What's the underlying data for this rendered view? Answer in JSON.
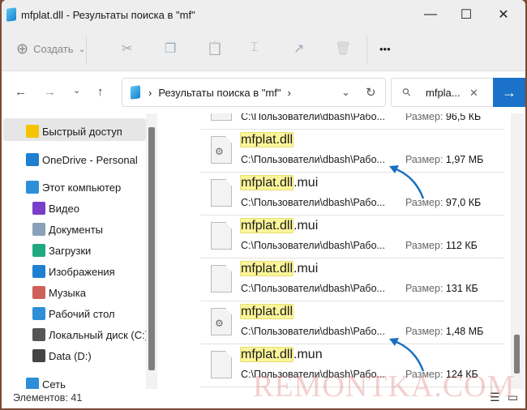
{
  "window": {
    "title": "mfplat.dll - Результаты поиска в \"mf\"",
    "minimize": "—",
    "maximize": "☐",
    "close": "✕"
  },
  "toolbar": {
    "create_label": "Создать",
    "create_icon": "⊕",
    "chevron": "⌄",
    "cut": "✂",
    "copy": "❐",
    "paste": "📋",
    "rename": "⌶",
    "share": "↗",
    "delete": "🗑",
    "more": "•••"
  },
  "nav": {
    "back": "←",
    "forward": "→",
    "recent": "⌄",
    "up": "↑",
    "breadcrumb_sep": "›",
    "location": "Результаты поиска в \"mf\"",
    "dropdown": "⌄",
    "refresh": "↻"
  },
  "search": {
    "value": "mfpla...",
    "icon": "⚲",
    "clear": "✕",
    "go": "→"
  },
  "sidebar": {
    "items": [
      {
        "label": "Быстрый доступ",
        "icon": "star-icon",
        "color": "#f5c400"
      },
      {
        "label": "OneDrive - Personal",
        "icon": "cloud-icon",
        "color": "#1f7fd0"
      },
      {
        "label": "Этот компьютер",
        "icon": "computer-icon",
        "color": "#2d8fd8"
      },
      {
        "label": "Видео",
        "icon": "video-icon",
        "color": "#7a3fc8"
      },
      {
        "label": "Документы",
        "icon": "documents-icon",
        "color": "#8aa0b8"
      },
      {
        "label": "Загрузки",
        "icon": "download-icon",
        "color": "#20a880"
      },
      {
        "label": "Изображения",
        "icon": "pictures-icon",
        "color": "#1f7fd0"
      },
      {
        "label": "Музыка",
        "icon": "music-icon",
        "color": "#d0605a"
      },
      {
        "label": "Рабочий стол",
        "icon": "desktop-icon",
        "color": "#2d8fd8"
      },
      {
        "label": "Локальный диск (C:)",
        "icon": "drive-c-icon",
        "color": "#555555"
      },
      {
        "label": "Data (D:)",
        "icon": "drive-icon",
        "color": "#444444"
      },
      {
        "label": "Сеть",
        "icon": "network-icon",
        "color": "#2d8fd8"
      }
    ]
  },
  "files": {
    "size_label": "Размер:",
    "items": [
      {
        "match": "",
        "rest": "",
        "path": "C:\\Пользователи\\dbash\\Рабо...",
        "size": "96,5 КБ",
        "type": "blank"
      },
      {
        "match": "mfplat.dll",
        "rest": "",
        "path": "C:\\Пользователи\\dbash\\Рабо...",
        "size": "1,97 МБ",
        "type": "dll"
      },
      {
        "match": "mfplat.dll",
        "rest": ".mui",
        "path": "C:\\Пользователи\\dbash\\Рабо...",
        "size": "97,0 КБ",
        "type": "blank"
      },
      {
        "match": "mfplat.dll",
        "rest": ".mui",
        "path": "C:\\Пользователи\\dbash\\Рабо...",
        "size": "112 КБ",
        "type": "blank"
      },
      {
        "match": "mfplat.dll",
        "rest": ".mui",
        "path": "C:\\Пользователи\\dbash\\Рабо...",
        "size": "131 КБ",
        "type": "blank"
      },
      {
        "match": "mfplat.dll",
        "rest": "",
        "path": "C:\\Пользователи\\dbash\\Рабо...",
        "size": "1,48 МБ",
        "type": "dll"
      },
      {
        "match": "mfplat.dll",
        "rest": ".mun",
        "path": "C:\\Пользователи\\dbash\\Рабо...",
        "size": "124 КБ",
        "type": "blank"
      }
    ]
  },
  "status": {
    "count": "Элементов: 41",
    "details_view": "☰",
    "tiles_view": "▭"
  },
  "watermark": "REMONTKA.COM",
  "accent": "#1a73c8"
}
